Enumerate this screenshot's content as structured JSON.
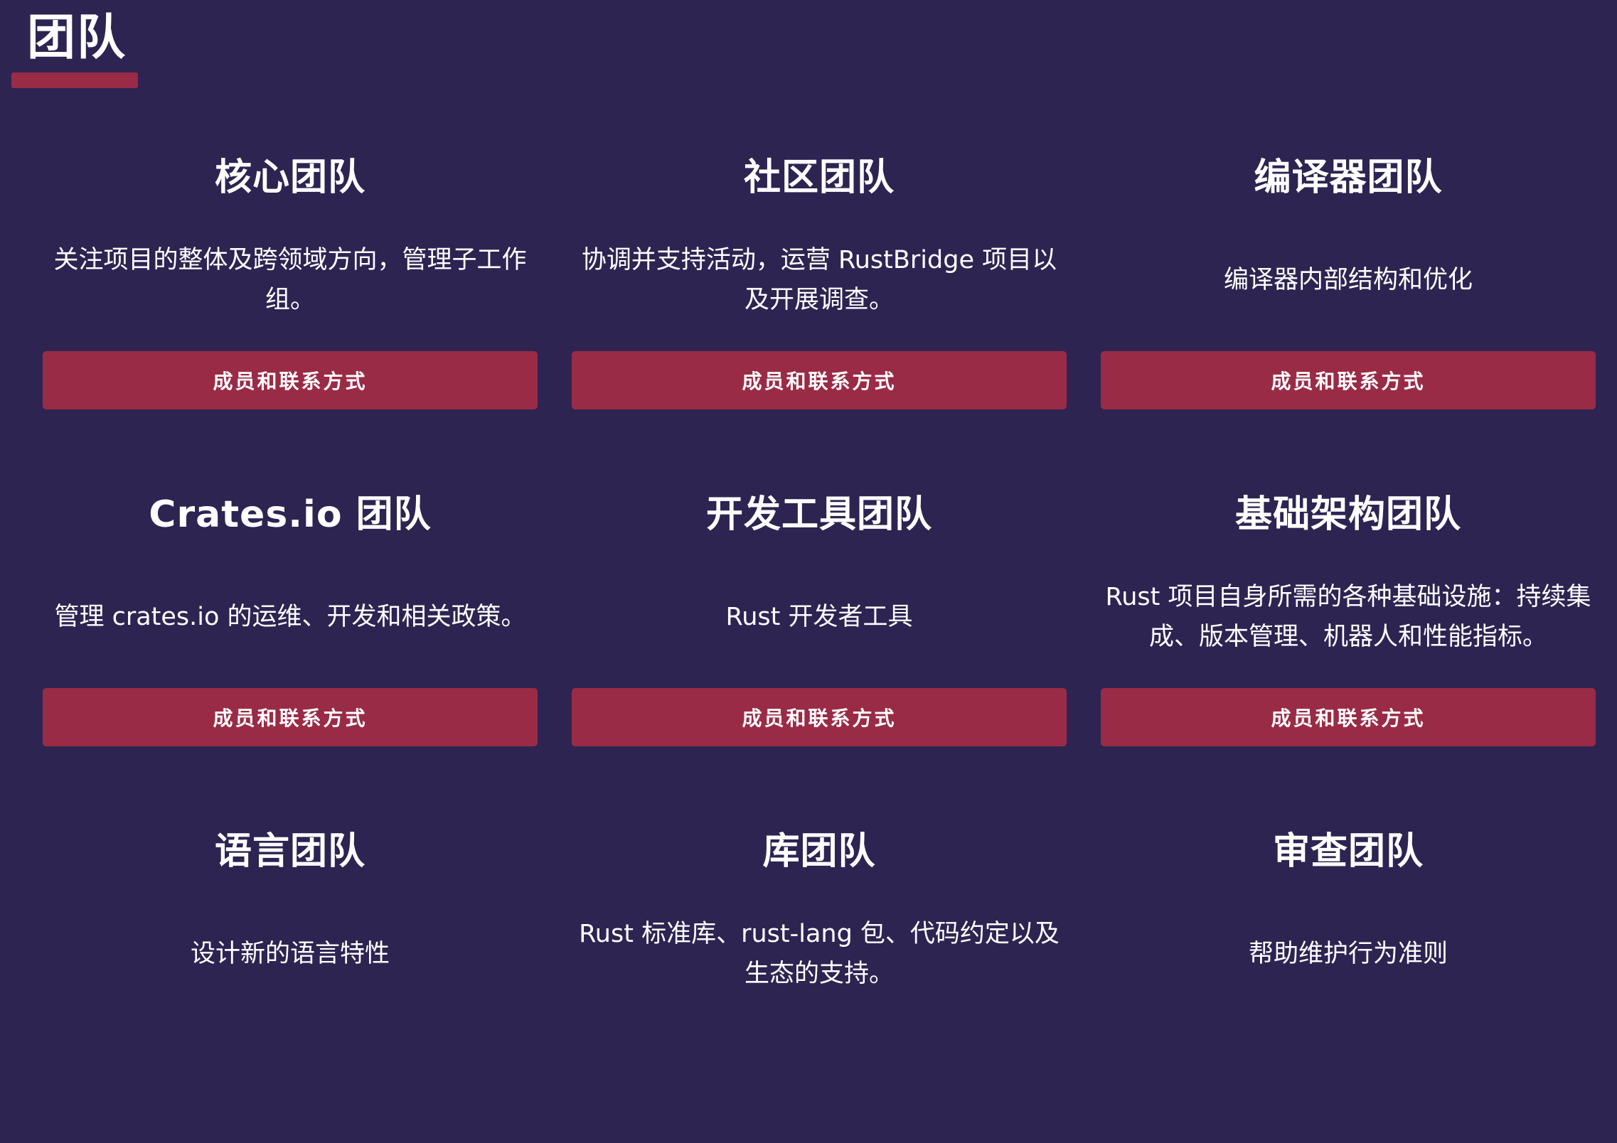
{
  "section": {
    "title": "团队"
  },
  "button_label": "成员和联系方式",
  "teams": [
    {
      "name": "核心团队",
      "description": "关注项目的整体及跨领域方向，管理子工作组。",
      "button": "成员和联系方式"
    },
    {
      "name": "社区团队",
      "description": "协调并支持活动，运营 RustBridge 项目以及开展调查。",
      "button": "成员和联系方式"
    },
    {
      "name": "编译器团队",
      "description": "编译器内部结构和优化",
      "button": "成员和联系方式"
    },
    {
      "name": "Crates.io 团队",
      "description": "管理 crates.io 的运维、开发和相关政策。",
      "button": "成员和联系方式"
    },
    {
      "name": "开发工具团队",
      "description": "Rust 开发者工具",
      "button": "成员和联系方式"
    },
    {
      "name": "基础架构团队",
      "description": "Rust 项目自身所需的各种基础设施：持续集成、版本管理、机器人和性能指标。",
      "button": "成员和联系方式"
    },
    {
      "name": "语言团队",
      "description": "设计新的语言特性",
      "button": null
    },
    {
      "name": "库团队",
      "description": "Rust 标准库、rust-lang 包、代码约定以及生态的支持。",
      "button": null
    },
    {
      "name": "审查团队",
      "description": "帮助维护行为准则",
      "button": null
    }
  ],
  "colors": {
    "background": "#2d2452",
    "accent": "#9a2b46",
    "text": "#ffffff"
  }
}
